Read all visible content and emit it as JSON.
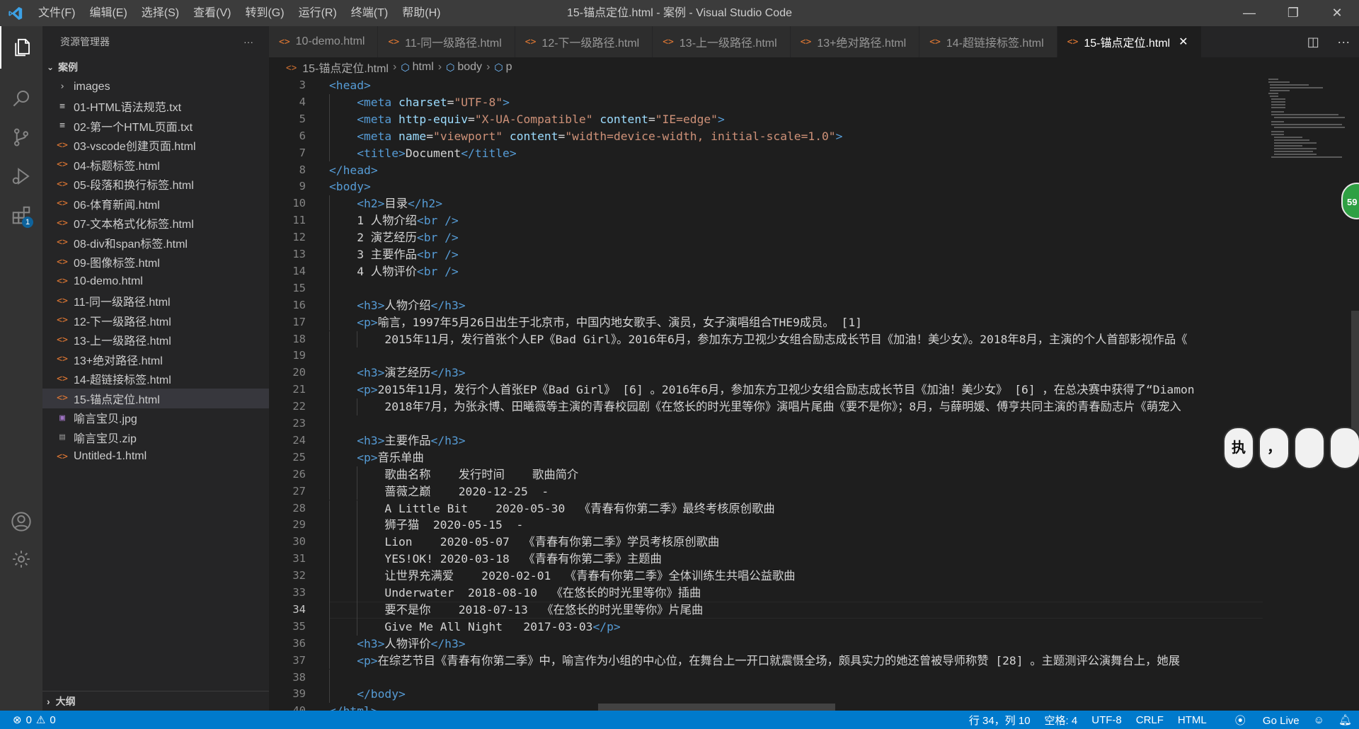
{
  "window": {
    "title": "15-锚点定位.html - 案例 - Visual Studio Code",
    "menu": [
      "文件(F)",
      "编辑(E)",
      "选择(S)",
      "查看(V)",
      "转到(G)",
      "运行(R)",
      "终端(T)",
      "帮助(H)"
    ],
    "controls": {
      "minimize": "—",
      "restore": "❐",
      "close": "✕"
    }
  },
  "activity": {
    "extensions_badge": "1"
  },
  "sidebar": {
    "title": "资源管理器",
    "more": "···",
    "folder": "案例",
    "outline": "大纲",
    "items": [
      {
        "name": "images",
        "kind": "dir",
        "icon": "›"
      },
      {
        "name": "01-HTML语法规范.txt",
        "kind": "txt",
        "icon": "≡"
      },
      {
        "name": "02-第一个HTML页面.txt",
        "kind": "txt",
        "icon": "≡"
      },
      {
        "name": "03-vscode创建页面.html",
        "kind": "html",
        "icon": "<>"
      },
      {
        "name": "04-标题标签.html",
        "kind": "html",
        "icon": "<>"
      },
      {
        "name": "05-段落和换行标签.html",
        "kind": "html",
        "icon": "<>"
      },
      {
        "name": "06-体育新闻.html",
        "kind": "html",
        "icon": "<>"
      },
      {
        "name": "07-文本格式化标签.html",
        "kind": "html",
        "icon": "<>"
      },
      {
        "name": "08-div和span标签.html",
        "kind": "html",
        "icon": "<>"
      },
      {
        "name": "09-图像标签.html",
        "kind": "html",
        "icon": "<>"
      },
      {
        "name": "10-demo.html",
        "kind": "html",
        "icon": "<>"
      },
      {
        "name": "11-同一级路径.html",
        "kind": "html",
        "icon": "<>"
      },
      {
        "name": "12-下一级路径.html",
        "kind": "html",
        "icon": "<>"
      },
      {
        "name": "13-上一级路径.html",
        "kind": "html",
        "icon": "<>"
      },
      {
        "name": "13+绝对路径.html",
        "kind": "html",
        "icon": "<>"
      },
      {
        "name": "14-超链接标签.html",
        "kind": "html",
        "icon": "<>"
      },
      {
        "name": "15-锚点定位.html",
        "kind": "html",
        "icon": "<>",
        "selected": true
      },
      {
        "name": "喻言宝贝.jpg",
        "kind": "img",
        "icon": "▣"
      },
      {
        "name": "喻言宝贝.zip",
        "kind": "zip",
        "icon": "▤"
      },
      {
        "name": "Untitled-1.html",
        "kind": "html",
        "icon": "<>"
      }
    ]
  },
  "tabs": [
    {
      "label": "10-demo.html"
    },
    {
      "label": "11-同一级路径.html"
    },
    {
      "label": "12-下一级路径.html"
    },
    {
      "label": "13-上一级路径.html"
    },
    {
      "label": "13+绝对路径.html"
    },
    {
      "label": "14-超链接标签.html"
    },
    {
      "label": "15-锚点定位.html",
      "active": true
    }
  ],
  "breadcrumb": [
    "15-锚点定位.html",
    "html",
    "body",
    "p"
  ],
  "editor": {
    "current_line": 34,
    "lines": [
      {
        "n": 3,
        "indent": 0,
        "tokens": [
          [
            "t",
            "<head>"
          ]
        ]
      },
      {
        "n": 4,
        "indent": 1,
        "tokens": [
          [
            "t",
            "<meta "
          ],
          [
            "a",
            "charset"
          ],
          [
            "d",
            "="
          ],
          [
            "s",
            "\"UTF-8\""
          ],
          [
            "t",
            ">"
          ]
        ]
      },
      {
        "n": 5,
        "indent": 1,
        "tokens": [
          [
            "t",
            "<meta "
          ],
          [
            "a",
            "http-equiv"
          ],
          [
            "d",
            "="
          ],
          [
            "s",
            "\"X-UA-Compatible\""
          ],
          [
            "d",
            " "
          ],
          [
            "a",
            "content"
          ],
          [
            "d",
            "="
          ],
          [
            "s",
            "\"IE=edge\""
          ],
          [
            "t",
            ">"
          ]
        ]
      },
      {
        "n": 6,
        "indent": 1,
        "tokens": [
          [
            "t",
            "<meta "
          ],
          [
            "a",
            "name"
          ],
          [
            "d",
            "="
          ],
          [
            "s",
            "\"viewport\""
          ],
          [
            "d",
            " "
          ],
          [
            "a",
            "content"
          ],
          [
            "d",
            "="
          ],
          [
            "s",
            "\"width=device-width, initial-scale=1.0\""
          ],
          [
            "t",
            ">"
          ]
        ]
      },
      {
        "n": 7,
        "indent": 1,
        "tokens": [
          [
            "t",
            "<title>"
          ],
          [
            "d",
            "Document"
          ],
          [
            "t",
            "</title>"
          ]
        ]
      },
      {
        "n": 8,
        "indent": 0,
        "tokens": [
          [
            "t",
            "</head>"
          ]
        ]
      },
      {
        "n": 9,
        "indent": 0,
        "tokens": [
          [
            "t",
            "<body>"
          ]
        ]
      },
      {
        "n": 10,
        "indent": 1,
        "tokens": [
          [
            "t",
            "<h2>"
          ],
          [
            "d",
            "目录"
          ],
          [
            "t",
            "</h2>"
          ]
        ]
      },
      {
        "n": 11,
        "indent": 1,
        "tokens": [
          [
            "d",
            "1 人物介绍"
          ],
          [
            "t",
            "<br />"
          ]
        ]
      },
      {
        "n": 12,
        "indent": 1,
        "tokens": [
          [
            "d",
            "2 演艺经历"
          ],
          [
            "t",
            "<br />"
          ]
        ]
      },
      {
        "n": 13,
        "indent": 1,
        "tokens": [
          [
            "d",
            "3 主要作品"
          ],
          [
            "t",
            "<br />"
          ]
        ]
      },
      {
        "n": 14,
        "indent": 1,
        "tokens": [
          [
            "d",
            "4 人物评价"
          ],
          [
            "t",
            "<br />"
          ]
        ]
      },
      {
        "n": 15,
        "indent": 1,
        "tokens": []
      },
      {
        "n": 16,
        "indent": 1,
        "tokens": [
          [
            "t",
            "<h3>"
          ],
          [
            "d",
            "人物介绍"
          ],
          [
            "t",
            "</h3>"
          ]
        ]
      },
      {
        "n": 17,
        "indent": 1,
        "tokens": [
          [
            "t",
            "<p>"
          ],
          [
            "d",
            "喻言，1997年5月26日出生于北京市，中国内地女歌手、演员，女子演唱组合THE9成员。 [1]"
          ]
        ]
      },
      {
        "n": 18,
        "indent": 2,
        "tokens": [
          [
            "d",
            "2015年11月，发行首张个人EP《Bad Girl》。2016年6月，参加东方卫视少女组合励志成长节目《加油！美少女》。2018年8月，主演的个人首部影视作品《"
          ]
        ]
      },
      {
        "n": 19,
        "indent": 1,
        "tokens": []
      },
      {
        "n": 20,
        "indent": 1,
        "tokens": [
          [
            "t",
            "<h3>"
          ],
          [
            "d",
            "演艺经历"
          ],
          [
            "t",
            "</h3>"
          ]
        ]
      },
      {
        "n": 21,
        "indent": 1,
        "tokens": [
          [
            "t",
            "<p>"
          ],
          [
            "d",
            "2015年11月，发行个人首张EP《Bad Girl》 [6] 。2016年6月，参加东方卫视少女组合励志成长节目《加油！美少女》 [6] ，在总决赛中获得了“Diamon"
          ]
        ]
      },
      {
        "n": 22,
        "indent": 2,
        "tokens": [
          [
            "d",
            "2018年7月，为张永博、田曦薇等主演的青春校园剧《在悠长的时光里等你》演唱片尾曲《要不是你》；8月，与薛明媛、傅亨共同主演的青春励志片《萌宠入"
          ]
        ]
      },
      {
        "n": 23,
        "indent": 1,
        "tokens": []
      },
      {
        "n": 24,
        "indent": 1,
        "tokens": [
          [
            "t",
            "<h3>"
          ],
          [
            "d",
            "主要作品"
          ],
          [
            "t",
            "</h3>"
          ]
        ]
      },
      {
        "n": 25,
        "indent": 1,
        "tokens": [
          [
            "t",
            "<p>"
          ],
          [
            "d",
            "音乐单曲"
          ]
        ]
      },
      {
        "n": 26,
        "indent": 2,
        "tokens": [
          [
            "d",
            "歌曲名称    发行时间    歌曲简介"
          ]
        ]
      },
      {
        "n": 27,
        "indent": 2,
        "tokens": [
          [
            "d",
            "蔷薇之巅    2020-12-25  -"
          ]
        ]
      },
      {
        "n": 28,
        "indent": 2,
        "tokens": [
          [
            "d",
            "A Little Bit    2020-05-30  《青春有你第二季》最终考核原创歌曲"
          ]
        ]
      },
      {
        "n": 29,
        "indent": 2,
        "tokens": [
          [
            "d",
            "狮子猫  2020-05-15  -"
          ]
        ]
      },
      {
        "n": 30,
        "indent": 2,
        "tokens": [
          [
            "d",
            "Lion    2020-05-07  《青春有你第二季》学员考核原创歌曲"
          ]
        ]
      },
      {
        "n": 31,
        "indent": 2,
        "tokens": [
          [
            "d",
            "YES!OK! 2020-03-18  《青春有你第二季》主题曲"
          ]
        ]
      },
      {
        "n": 32,
        "indent": 2,
        "tokens": [
          [
            "d",
            "让世界充满爱    2020-02-01  《青春有你第二季》全体训练生共唱公益歌曲"
          ]
        ]
      },
      {
        "n": 33,
        "indent": 2,
        "tokens": [
          [
            "d",
            "Underwater  2018-08-10  《在悠长的时光里等你》插曲"
          ]
        ]
      },
      {
        "n": 34,
        "indent": 2,
        "tokens": [
          [
            "d",
            "要不是你    2018-07-13  《在悠长的时光里等你》片尾曲"
          ]
        ]
      },
      {
        "n": 35,
        "indent": 2,
        "tokens": [
          [
            "d",
            "Give Me All Night   2017-03-03"
          ],
          [
            "t",
            "</p>"
          ]
        ]
      },
      {
        "n": 36,
        "indent": 1,
        "tokens": [
          [
            "t",
            "<h3>"
          ],
          [
            "d",
            "人物评价"
          ],
          [
            "t",
            "</h3>"
          ]
        ]
      },
      {
        "n": 37,
        "indent": 1,
        "tokens": [
          [
            "t",
            "<p>"
          ],
          [
            "d",
            "在综艺节目《青春有你第二季》中，喻言作为小组的中心位，在舞台上一开口就震慑全场，颇具实力的她还曾被导师称赞 [28] 。主题测评公演舞台上，她展"
          ]
        ]
      },
      {
        "n": 38,
        "indent": 1,
        "tokens": []
      },
      {
        "n": 39,
        "indent": 1,
        "tokens": [
          [
            "t",
            "</body>"
          ]
        ]
      },
      {
        "n": 40,
        "indent": 0,
        "tokens": [
          [
            "t",
            "</html>"
          ]
        ]
      }
    ]
  },
  "overlay": {
    "green_ball": "59",
    "stickers": [
      "执",
      "，",
      "",
      ""
    ]
  },
  "statusbar": {
    "errors": "0",
    "warnings": "0",
    "position": "行 34，列 10",
    "spaces": "空格: 4",
    "encoding": "UTF-8",
    "eol": "CRLF",
    "language": "HTML",
    "golive": "Go Live"
  },
  "colors": {
    "accent": "#007acc",
    "tag": "#569cd6",
    "attr": "#9cdcfe",
    "string": "#ce9178",
    "html_icon": "#e37933"
  }
}
